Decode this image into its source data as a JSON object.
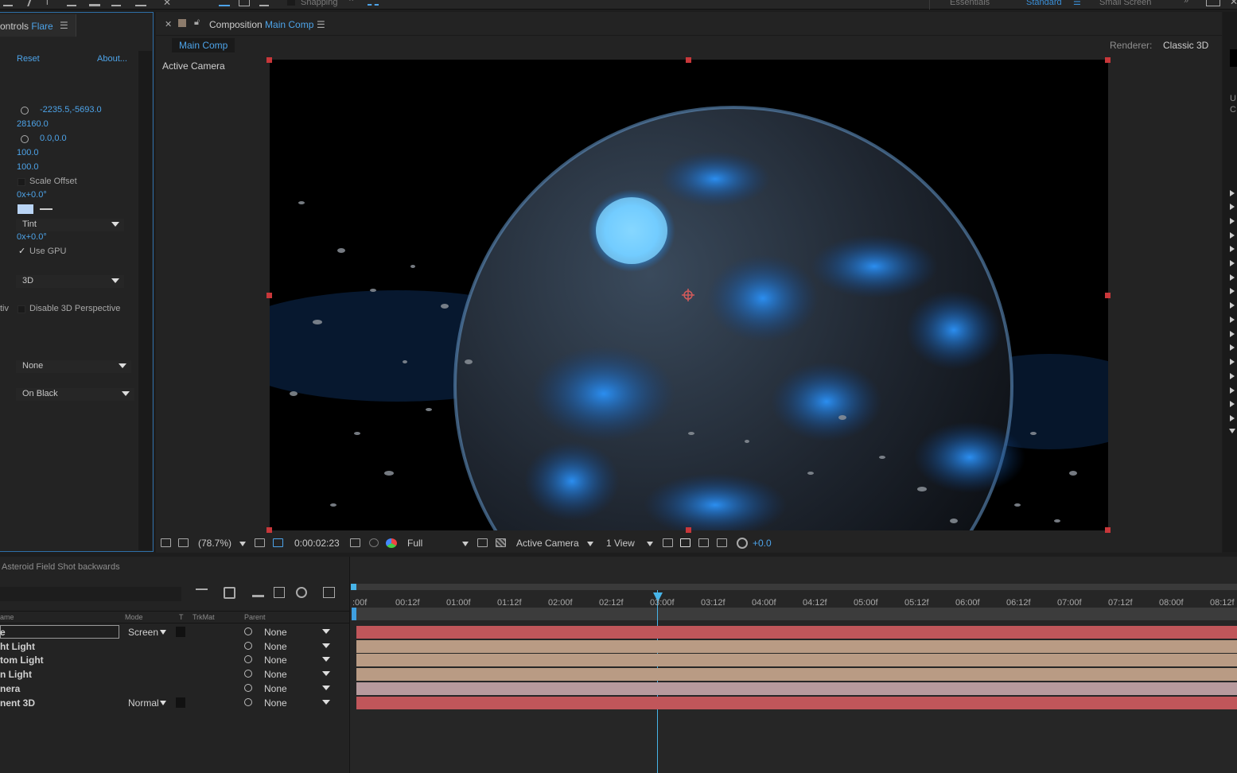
{
  "toolbar": {
    "snapping": "Snapping",
    "workspaces": [
      "Essentials",
      "Standard",
      "Small Screen"
    ],
    "active_workspace": "Standard"
  },
  "effect_controls": {
    "tab_prefix": "ontrols",
    "tab_layer": "Flare",
    "reset": "Reset",
    "about": "About...",
    "position_value": "-2235.5,-5693.0",
    "value_28160": "28160.0",
    "position2_value": "0.0,0.0",
    "v100a": "100.0",
    "v100b": "100.0",
    "scale_offset": "Scale Offset",
    "angle1": "0x+0.0°",
    "tint_dropdown": "Tint",
    "angle2": "0x+0.0°",
    "use_gpu": "Use GPU",
    "use_gpu_checked": true,
    "render_dropdown": "3D",
    "disable_3d_prefix": "tiv",
    "disable_3d": "Disable 3D Perspective",
    "none_dropdown": "None",
    "onblack_dropdown": "On Black",
    "swatch_color": "#b9d4f5"
  },
  "composition": {
    "tab_prefix": "Composition",
    "tab_name": "Main Comp",
    "breadcrumb": "Main Comp",
    "renderer_label": "Renderer:",
    "renderer_value": "Classic 3D",
    "active_camera_label": "Active Camera",
    "footer": {
      "zoom": "(78.7%)",
      "timecode": "0:00:02:23",
      "resolution": "Full",
      "view": "Active Camera",
      "views": "1 View",
      "exposure": "+0.0"
    }
  },
  "timeline": {
    "comp_title": "Asteroid Field Shot backwards",
    "columns": {
      "name": "ame",
      "mode": "Mode",
      "t": "T",
      "trkmat": "TrkMat",
      "parent": "Parent"
    },
    "ticks": [
      ":00f",
      "00:12f",
      "01:00f",
      "01:12f",
      "02:00f",
      "02:12f",
      "03:00f",
      "03:12f",
      "04:00f",
      "04:12f",
      "05:00f",
      "05:12f",
      "06:00f",
      "06:12f",
      "07:00f",
      "07:12f",
      "08:00f",
      "08:12f"
    ],
    "layers": [
      {
        "name": "e",
        "mode": "Screen",
        "parent": "None",
        "bar_color": "#c0565a"
      },
      {
        "name": "ht Light",
        "mode": "",
        "parent": "None",
        "bar_color": "#b99b84"
      },
      {
        "name": "tom Light",
        "mode": "",
        "parent": "None",
        "bar_color": "#b99b84"
      },
      {
        "name": "n Light",
        "mode": "",
        "parent": "None",
        "bar_color": "#b99b84"
      },
      {
        "name": "nera",
        "mode": "",
        "parent": "None",
        "bar_color": "#b79a9d"
      },
      {
        "name": "nent 3D",
        "mode": "Normal",
        "parent": "None",
        "bar_color": "#c0565a"
      }
    ],
    "playhead_color": "#47b4e8"
  }
}
